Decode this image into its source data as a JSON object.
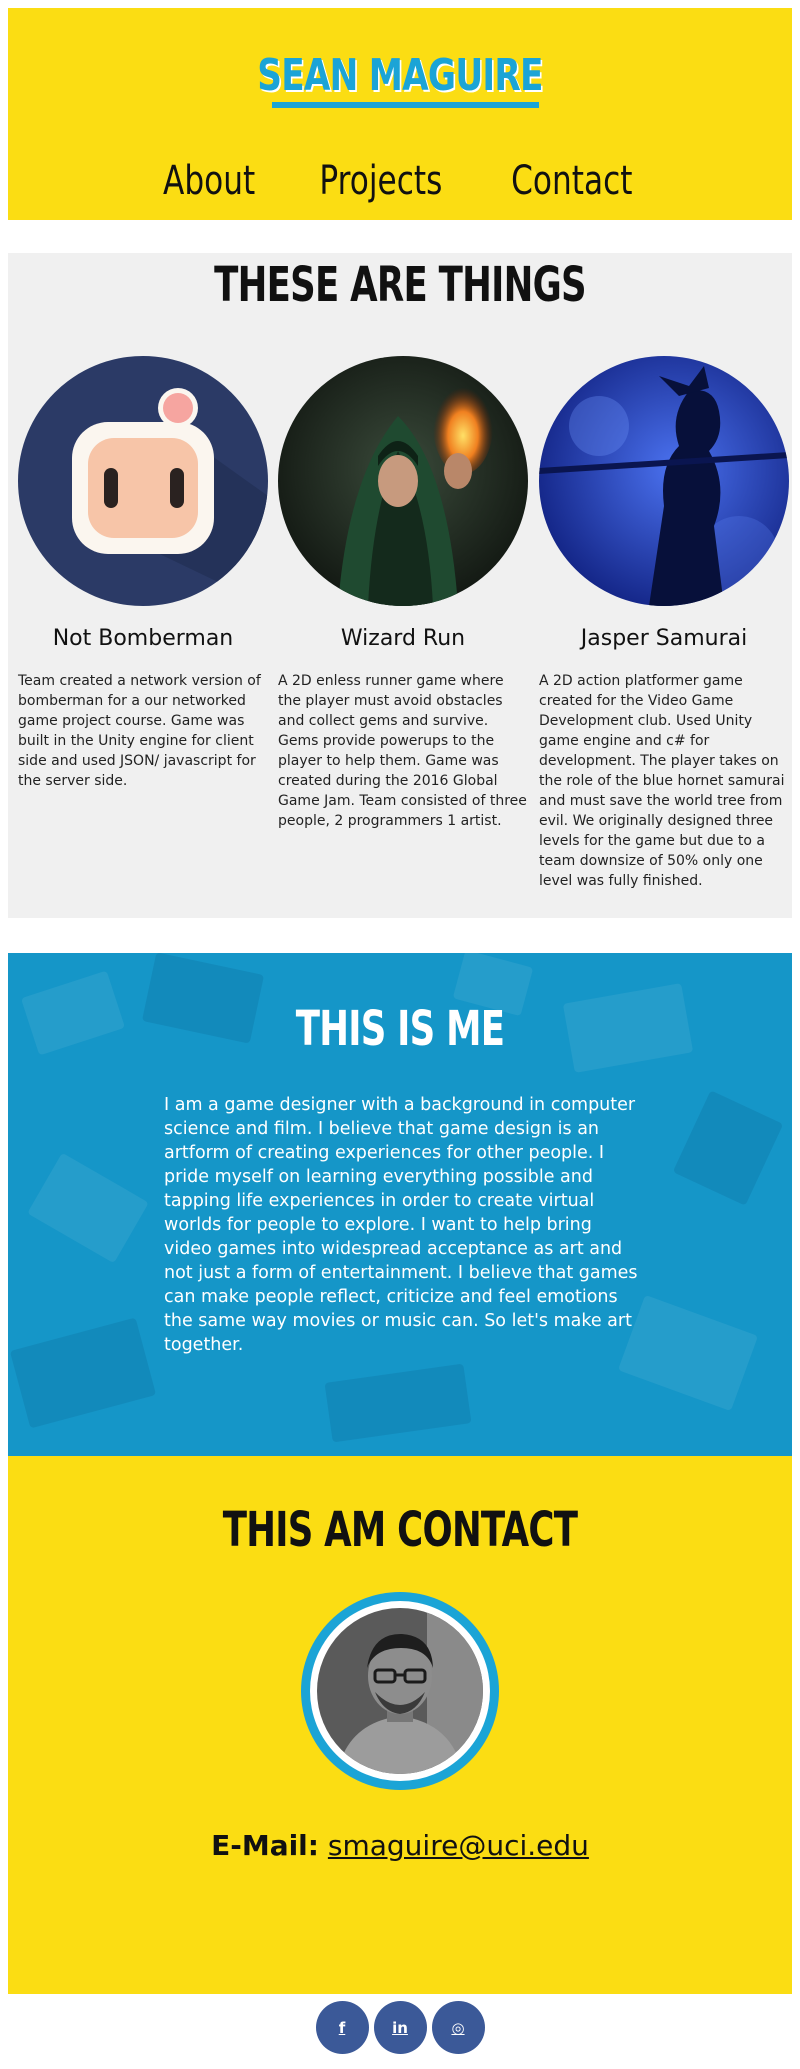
{
  "header": {
    "logo": "SEAN MAGUIRE",
    "nav": [
      "About",
      "Projects",
      "Contact"
    ]
  },
  "projects": {
    "title": "THESE ARE THINGS",
    "items": [
      {
        "name": "Not Bomberman",
        "description": "Team created a network version of bomberman for a our networked game project course. Game was built in the Unity engine for client side and used JSON/ javascript for the server side."
      },
      {
        "name": "Wizard Run",
        "description": "A 2D enless runner game where the player must avoid obstacles and collect gems and survive. Gems provide powerups to the player to help them. Game was created during the 2016 Global Game Jam. Team consisted of three people, 2 programmers 1 artist."
      },
      {
        "name": "Jasper Samurai",
        "description": "A 2D action platformer game created for the Video Game Development club. Used Unity game engine and c# for development. The player takes on the role of the blue hornet samurai and must save the world tree from evil. We originally designed three levels for the game but due to a team downsize of 50% only one level was fully finished."
      }
    ]
  },
  "about": {
    "title": "THIS IS ME",
    "bio": "I am a game designer with a background in computer science and film. I believe that game design is an artform of creating experiences for other people. I pride myself on learning everything possible and tapping life experiences in order to create virtual worlds for people to explore. I want to help bring video games into widespread acceptance as art and not just a form of entertainment. I believe that games can make people reflect, criticize and feel emotions the same way movies or music can. So let's make art together."
  },
  "contact": {
    "title": "THIS AM CONTACT",
    "email_label": "E-Mail:",
    "email": "smaguire@uci.edu"
  },
  "social": [
    {
      "icon": "facebook-icon",
      "glyph": "f"
    },
    {
      "icon": "linkedin-icon",
      "glyph": "in"
    },
    {
      "icon": "instagram-icon",
      "glyph": "◎"
    }
  ],
  "colors": {
    "yellow": "#fbdd13",
    "blue": "#1ba4d6",
    "about_bg": "#1596c8",
    "social": "#3b5998"
  }
}
